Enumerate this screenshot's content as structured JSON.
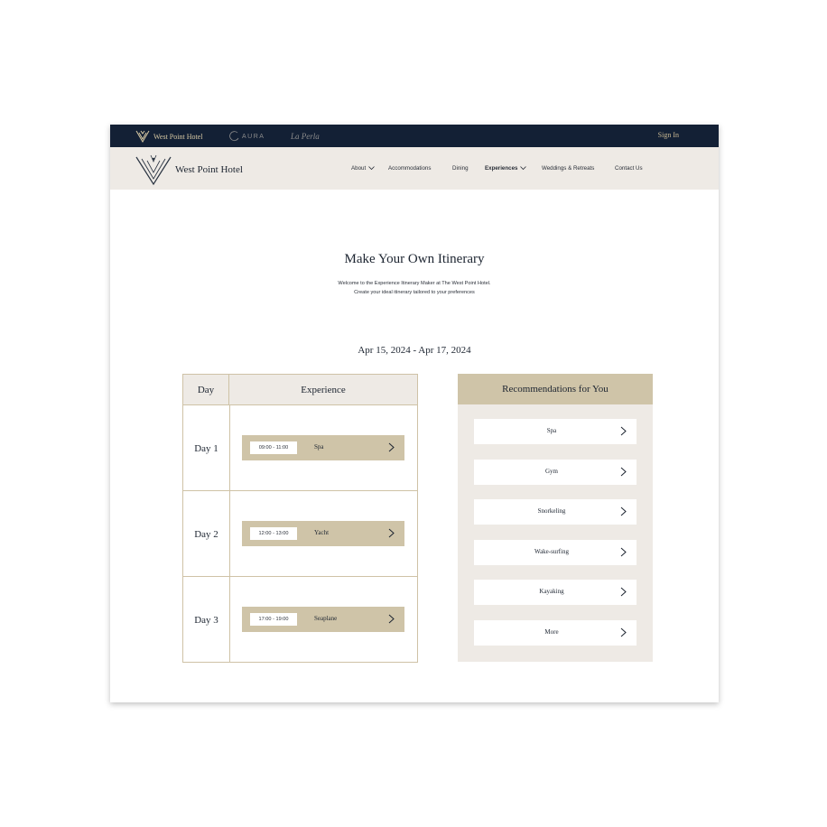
{
  "topbar": {
    "brands": [
      "West Point Hotel",
      "AURA",
      "La Perla"
    ],
    "signin": "Sign In"
  },
  "header": {
    "logo_text": "West Point Hotel",
    "nav": [
      "About",
      "Accommodations",
      "Dining",
      "Experiences",
      "Weddings & Retreats",
      "Contact Us"
    ],
    "active": "Experiences"
  },
  "main": {
    "title": "Make Your Own Itinerary",
    "subtitle_line1": "Welcome to the Experience Itinerary Maker at The West Point Hotel.",
    "subtitle_line2": "Create your ideal itinerary tailored to your preferences",
    "date_range": "Apr 15, 2024 - Apr 17, 2024"
  },
  "itinerary": {
    "headers": [
      "Day",
      "Experience"
    ],
    "rows": [
      {
        "day": "Day 1",
        "time": "09:00 - 11:00",
        "experience": "Spa"
      },
      {
        "day": "Day 2",
        "time": "12:00 - 13:00",
        "experience": "Yacht"
      },
      {
        "day": "Day 3",
        "time": "17:00 - 19:00",
        "experience": "Seaplane"
      }
    ]
  },
  "recommendations": {
    "title": "Recommendations for You",
    "items": [
      "Spa",
      "Gym",
      "Snorkeling",
      "Wake-surfing",
      "Kayaking",
      "More"
    ]
  },
  "colors": {
    "navy": "#132035",
    "beige": "#eeeae5",
    "tan": "#cfc4a8",
    "gold": "#c9b892"
  }
}
